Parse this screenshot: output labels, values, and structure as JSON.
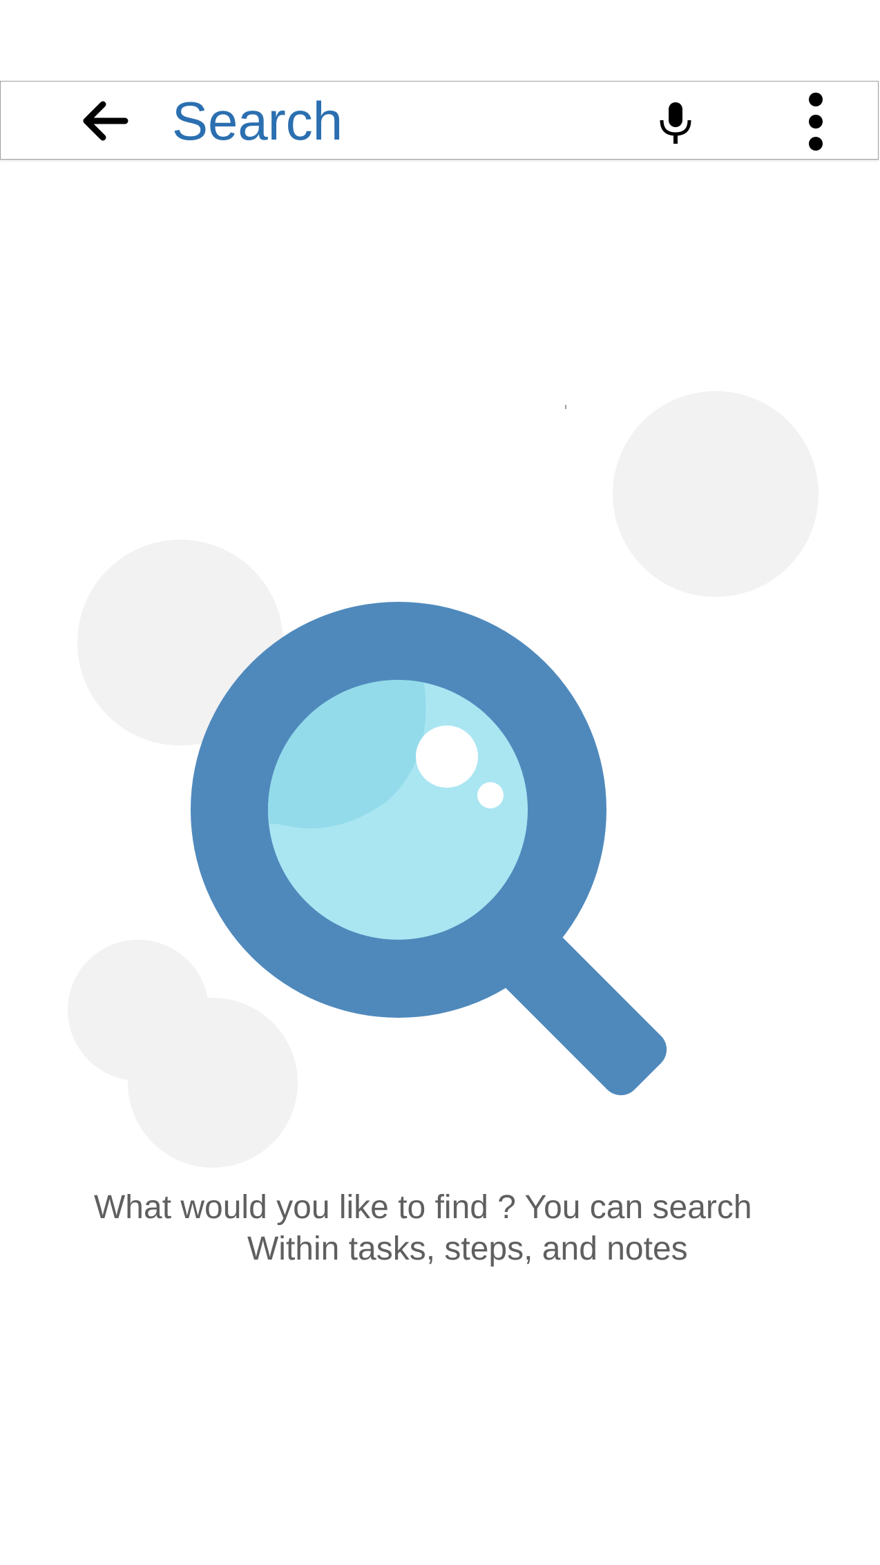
{
  "toolbar": {
    "back_icon": "arrow-left-icon",
    "search": {
      "placeholder": "Search",
      "value": ""
    },
    "mic_icon": "microphone-icon",
    "more_icon": "more-vert-icon"
  },
  "empty_state": {
    "illustration_icon": "magnifying-glass-icon",
    "hint_line1": "What would you like to find ? You can search",
    "hint_line2": "Within tasks, steps, and notes"
  },
  "colors": {
    "accent": "#2b6fb0",
    "glass_frame": "#4f89bc",
    "glass_lens": "#aae6f2",
    "bubble": "#f2f2f2",
    "hint_text": "#5f5f5f"
  }
}
